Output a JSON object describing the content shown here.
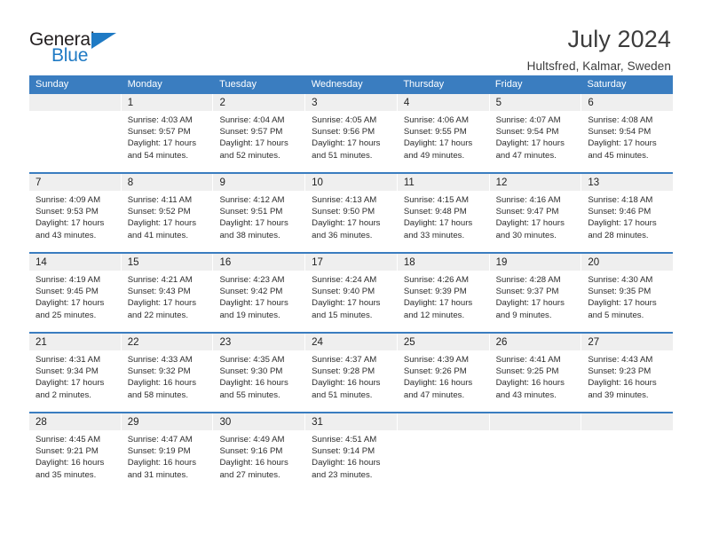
{
  "logo": {
    "word_one": "General",
    "word_two": "Blue",
    "triangle_icon": "triangle-icon",
    "accent_color": "#1f7ac4"
  },
  "header": {
    "title": "July 2024",
    "location": "Hultsfred, Kalmar, Sweden"
  },
  "calendar": {
    "header_bg": "#3a7dc0",
    "date_band_bg": "#efefef",
    "weekdays": [
      "Sunday",
      "Monday",
      "Tuesday",
      "Wednesday",
      "Thursday",
      "Friday",
      "Saturday"
    ],
    "weeks": [
      [
        {
          "date": "",
          "empty": true
        },
        {
          "date": "1",
          "sunrise": "Sunrise: 4:03 AM",
          "sunset": "Sunset: 9:57 PM",
          "daylight": "Daylight: 17 hours and 54 minutes."
        },
        {
          "date": "2",
          "sunrise": "Sunrise: 4:04 AM",
          "sunset": "Sunset: 9:57 PM",
          "daylight": "Daylight: 17 hours and 52 minutes."
        },
        {
          "date": "3",
          "sunrise": "Sunrise: 4:05 AM",
          "sunset": "Sunset: 9:56 PM",
          "daylight": "Daylight: 17 hours and 51 minutes."
        },
        {
          "date": "4",
          "sunrise": "Sunrise: 4:06 AM",
          "sunset": "Sunset: 9:55 PM",
          "daylight": "Daylight: 17 hours and 49 minutes."
        },
        {
          "date": "5",
          "sunrise": "Sunrise: 4:07 AM",
          "sunset": "Sunset: 9:54 PM",
          "daylight": "Daylight: 17 hours and 47 minutes."
        },
        {
          "date": "6",
          "sunrise": "Sunrise: 4:08 AM",
          "sunset": "Sunset: 9:54 PM",
          "daylight": "Daylight: 17 hours and 45 minutes."
        }
      ],
      [
        {
          "date": "7",
          "sunrise": "Sunrise: 4:09 AM",
          "sunset": "Sunset: 9:53 PM",
          "daylight": "Daylight: 17 hours and 43 minutes."
        },
        {
          "date": "8",
          "sunrise": "Sunrise: 4:11 AM",
          "sunset": "Sunset: 9:52 PM",
          "daylight": "Daylight: 17 hours and 41 minutes."
        },
        {
          "date": "9",
          "sunrise": "Sunrise: 4:12 AM",
          "sunset": "Sunset: 9:51 PM",
          "daylight": "Daylight: 17 hours and 38 minutes."
        },
        {
          "date": "10",
          "sunrise": "Sunrise: 4:13 AM",
          "sunset": "Sunset: 9:50 PM",
          "daylight": "Daylight: 17 hours and 36 minutes."
        },
        {
          "date": "11",
          "sunrise": "Sunrise: 4:15 AM",
          "sunset": "Sunset: 9:48 PM",
          "daylight": "Daylight: 17 hours and 33 minutes."
        },
        {
          "date": "12",
          "sunrise": "Sunrise: 4:16 AM",
          "sunset": "Sunset: 9:47 PM",
          "daylight": "Daylight: 17 hours and 30 minutes."
        },
        {
          "date": "13",
          "sunrise": "Sunrise: 4:18 AM",
          "sunset": "Sunset: 9:46 PM",
          "daylight": "Daylight: 17 hours and 28 minutes."
        }
      ],
      [
        {
          "date": "14",
          "sunrise": "Sunrise: 4:19 AM",
          "sunset": "Sunset: 9:45 PM",
          "daylight": "Daylight: 17 hours and 25 minutes."
        },
        {
          "date": "15",
          "sunrise": "Sunrise: 4:21 AM",
          "sunset": "Sunset: 9:43 PM",
          "daylight": "Daylight: 17 hours and 22 minutes."
        },
        {
          "date": "16",
          "sunrise": "Sunrise: 4:23 AM",
          "sunset": "Sunset: 9:42 PM",
          "daylight": "Daylight: 17 hours and 19 minutes."
        },
        {
          "date": "17",
          "sunrise": "Sunrise: 4:24 AM",
          "sunset": "Sunset: 9:40 PM",
          "daylight": "Daylight: 17 hours and 15 minutes."
        },
        {
          "date": "18",
          "sunrise": "Sunrise: 4:26 AM",
          "sunset": "Sunset: 9:39 PM",
          "daylight": "Daylight: 17 hours and 12 minutes."
        },
        {
          "date": "19",
          "sunrise": "Sunrise: 4:28 AM",
          "sunset": "Sunset: 9:37 PM",
          "daylight": "Daylight: 17 hours and 9 minutes."
        },
        {
          "date": "20",
          "sunrise": "Sunrise: 4:30 AM",
          "sunset": "Sunset: 9:35 PM",
          "daylight": "Daylight: 17 hours and 5 minutes."
        }
      ],
      [
        {
          "date": "21",
          "sunrise": "Sunrise: 4:31 AM",
          "sunset": "Sunset: 9:34 PM",
          "daylight": "Daylight: 17 hours and 2 minutes."
        },
        {
          "date": "22",
          "sunrise": "Sunrise: 4:33 AM",
          "sunset": "Sunset: 9:32 PM",
          "daylight": "Daylight: 16 hours and 58 minutes."
        },
        {
          "date": "23",
          "sunrise": "Sunrise: 4:35 AM",
          "sunset": "Sunset: 9:30 PM",
          "daylight": "Daylight: 16 hours and 55 minutes."
        },
        {
          "date": "24",
          "sunrise": "Sunrise: 4:37 AM",
          "sunset": "Sunset: 9:28 PM",
          "daylight": "Daylight: 16 hours and 51 minutes."
        },
        {
          "date": "25",
          "sunrise": "Sunrise: 4:39 AM",
          "sunset": "Sunset: 9:26 PM",
          "daylight": "Daylight: 16 hours and 47 minutes."
        },
        {
          "date": "26",
          "sunrise": "Sunrise: 4:41 AM",
          "sunset": "Sunset: 9:25 PM",
          "daylight": "Daylight: 16 hours and 43 minutes."
        },
        {
          "date": "27",
          "sunrise": "Sunrise: 4:43 AM",
          "sunset": "Sunset: 9:23 PM",
          "daylight": "Daylight: 16 hours and 39 minutes."
        }
      ],
      [
        {
          "date": "28",
          "sunrise": "Sunrise: 4:45 AM",
          "sunset": "Sunset: 9:21 PM",
          "daylight": "Daylight: 16 hours and 35 minutes."
        },
        {
          "date": "29",
          "sunrise": "Sunrise: 4:47 AM",
          "sunset": "Sunset: 9:19 PM",
          "daylight": "Daylight: 16 hours and 31 minutes."
        },
        {
          "date": "30",
          "sunrise": "Sunrise: 4:49 AM",
          "sunset": "Sunset: 9:16 PM",
          "daylight": "Daylight: 16 hours and 27 minutes."
        },
        {
          "date": "31",
          "sunrise": "Sunrise: 4:51 AM",
          "sunset": "Sunset: 9:14 PM",
          "daylight": "Daylight: 16 hours and 23 minutes."
        },
        {
          "date": "",
          "empty": true
        },
        {
          "date": "",
          "empty": true
        },
        {
          "date": "",
          "empty": true
        }
      ]
    ]
  }
}
